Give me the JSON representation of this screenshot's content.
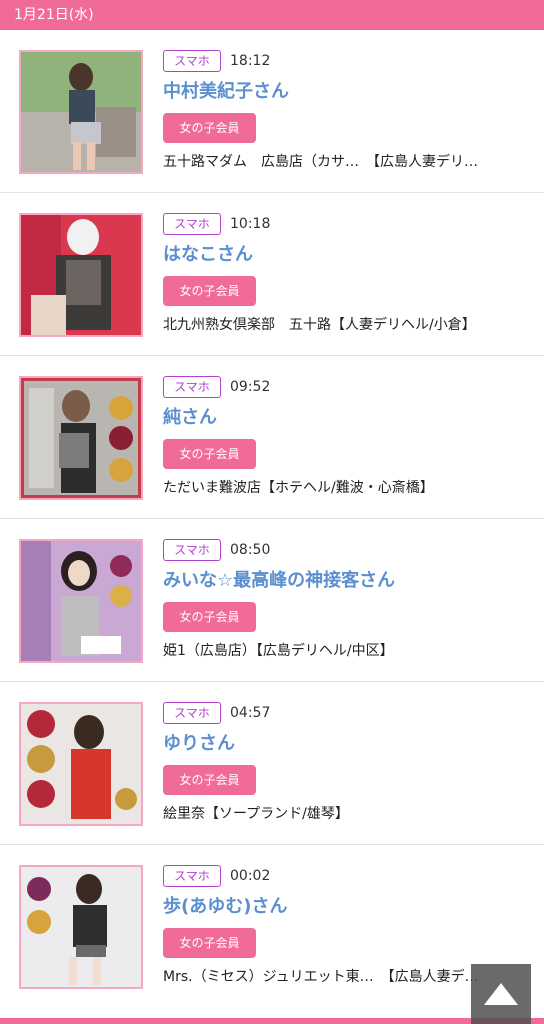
{
  "header": {
    "date": "1月21日(水)"
  },
  "colors": {
    "accent": "#f06b96",
    "name_link": "#5b8fd0",
    "device_badge": "#b33fcf"
  },
  "items": [
    {
      "device": "スマホ",
      "time": "18:12",
      "name": "中村美紀子さん",
      "member": "女の子会員",
      "shop": "五十路マダム　広島店（カサ…　【広島人妻デリ…"
    },
    {
      "device": "スマホ",
      "time": "10:18",
      "name": "はなこさん",
      "member": "女の子会員",
      "shop": "北九州熟女倶楽部　五十路【人妻デリヘル/小倉】"
    },
    {
      "device": "スマホ",
      "time": "09:52",
      "name": "純さん",
      "member": "女の子会員",
      "shop": "ただいま難波店【ホテヘル/難波・心斎橋】"
    },
    {
      "device": "スマホ",
      "time": "08:50",
      "name": "みいな☆最高峰の神接客さん",
      "member": "女の子会員",
      "shop": "姫1（広島店）【広島デリヘル/中区】"
    },
    {
      "device": "スマホ",
      "time": "04:57",
      "name": "ゆりさん",
      "member": "女の子会員",
      "shop": "絵里奈【ソープランド/雄琴】"
    },
    {
      "device": "スマホ",
      "time": "00:02",
      "name": "歩(あゆむ)さん",
      "member": "女の子会員",
      "shop": "Mrs.（ミセス）ジュリエット東…　【広島人妻デ…"
    }
  ],
  "scroll_top": {
    "icon": "triangle-up-icon"
  }
}
